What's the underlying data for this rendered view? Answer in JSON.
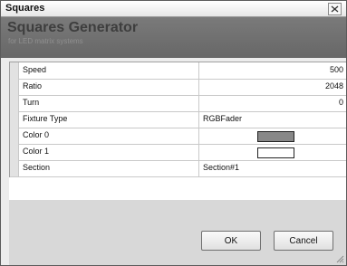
{
  "window": {
    "title": "Squares"
  },
  "banner": {
    "title": "Squares Generator",
    "subtitle": "for LED matrix systems"
  },
  "properties": [
    {
      "name": "Speed",
      "value": "500",
      "kind": "number"
    },
    {
      "name": "Ratio",
      "value": "2048",
      "kind": "number"
    },
    {
      "name": "Turn",
      "value": "0",
      "kind": "number"
    },
    {
      "name": "Fixture Type",
      "value": "RGBFader",
      "kind": "text"
    },
    {
      "name": "Color 0",
      "value": "",
      "kind": "color",
      "color": "#888888"
    },
    {
      "name": "Color 1",
      "value": "",
      "kind": "color",
      "color": "#ffffff"
    },
    {
      "name": "Section",
      "value": "Section#1",
      "kind": "text"
    }
  ],
  "buttons": {
    "ok": "OK",
    "cancel": "Cancel"
  }
}
